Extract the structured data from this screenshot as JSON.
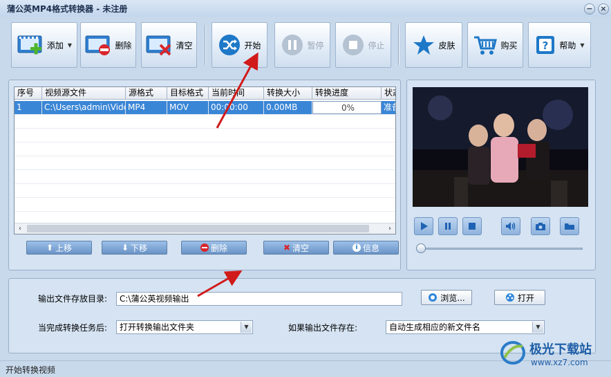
{
  "window": {
    "title": "蒲公英MP4格式转换器 - 未注册",
    "min_label": "−",
    "close_label": "×"
  },
  "toolbar": {
    "add": "添加",
    "delete": "删除",
    "clear": "清空",
    "start": "开始",
    "pause": "暂停",
    "stop": "停止",
    "skin": "皮肤",
    "buy": "购买",
    "help": "帮助"
  },
  "table": {
    "columns": [
      "序号",
      "视频源文件",
      "源格式",
      "目标格式",
      "当前时间",
      "转换大小",
      "转换进度",
      "状态"
    ],
    "rows": [
      {
        "index": "1",
        "file": "C:\\Users\\admin\\Video...",
        "src": "MP4",
        "dst": "MOV",
        "time": "00:00:00",
        "size": "0.00MB",
        "progress": "0%",
        "status": "准备"
      }
    ]
  },
  "list_actions": {
    "up": "上移",
    "down": "下移",
    "delete": "删除",
    "clear": "清空",
    "info": "信息"
  },
  "settings": {
    "output_dir_label": "输出文件存放目录:",
    "output_dir_value": "C:\\蒲公英视频输出",
    "browse": "浏览...",
    "open": "打开",
    "after_done_label": "当完成转换任务后:",
    "after_done_value": "打开转换输出文件夹",
    "if_exists_label": "如果输出文件存在:",
    "if_exists_value": "自动生成相应的新文件名"
  },
  "status": {
    "text": "开始转换视频"
  },
  "watermark": {
    "text": "极光下载站",
    "url": "www.xz7.com"
  },
  "colors": {
    "accent": "#3a86d6",
    "window_bg": "#c8d9ec",
    "panel_bg": "#d5e3f2",
    "arrow": "#d11a1a"
  }
}
